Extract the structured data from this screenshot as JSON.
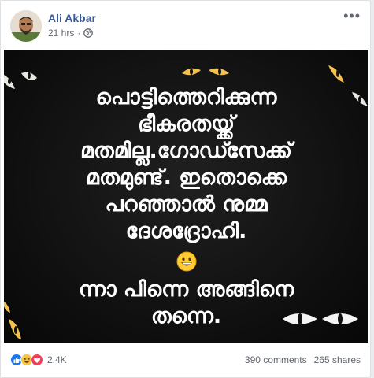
{
  "post": {
    "author": "Ali Akbar",
    "timestamp": "21 hrs",
    "separator": "·",
    "privacy_icon": "globe-icon",
    "more_icon": "more-options-icon",
    "image_text": {
      "lines_top": [
        "പൊട്ടിത്തെറിക്കുന്ന",
        "ഭീകരതയ്ക്ക്",
        "മതമില്ല.ഗോഡ്സേക്ക്",
        "മതമുണ്ട്. ഇതൊക്കെ",
        "പറഞ്ഞാൽ നുമ്മ",
        "ദേശദ്രോഹി."
      ],
      "emoji": "grinning-face-emoji",
      "lines_bottom": [
        "ന്നാ പിന്നെ അങ്ങിനെ",
        "തന്നെ."
      ]
    },
    "colors": {
      "author": "#385898",
      "eyes": "#f2c14e",
      "eye_white": "#f5f5f5",
      "image_bg": "#111111"
    }
  },
  "stats": {
    "reaction_icons": [
      "like-icon",
      "haha-icon",
      "love-icon"
    ],
    "reaction_count": "2.4K",
    "comments": "390 comments",
    "shares": "265 shares"
  }
}
